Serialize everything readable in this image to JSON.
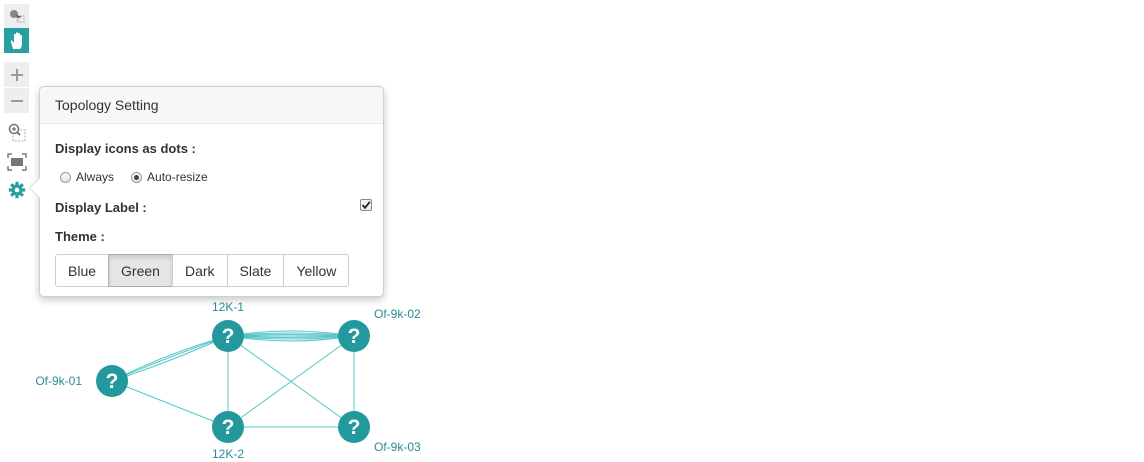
{
  "toolbar": {
    "buttons": [
      "select-tool",
      "move-tool",
      "zoom-in",
      "zoom-out",
      "zoom-by-selection",
      "fit-stage",
      "settings"
    ]
  },
  "popover": {
    "title": "Topology Setting",
    "dots_label": "Display icons as dots :",
    "dots_options": [
      "Always",
      "Auto-resize"
    ],
    "dots_selected": "Auto-resize",
    "display_label": "Display Label :",
    "display_label_checked": true,
    "theme_label": "Theme :",
    "themes": [
      "Blue",
      "Green",
      "Dark",
      "Slate",
      "Yellow"
    ],
    "theme_selected": "Green"
  },
  "topology": {
    "node_color": "#23999e",
    "link_color": "#57c4c6",
    "node_glyph": "?",
    "nodes": [
      {
        "label": "12K-1"
      },
      {
        "label": "Of-9k-02"
      },
      {
        "label": "Of-9k-01"
      },
      {
        "label": "12K-2"
      },
      {
        "label": "Of-9k-03"
      }
    ]
  }
}
